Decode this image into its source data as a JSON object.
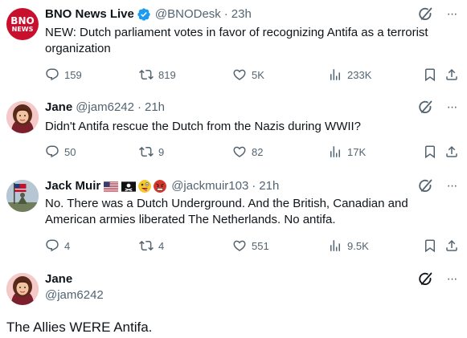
{
  "tweets": [
    {
      "name": "BNO News Live",
      "handle": "@BNODesk",
      "sep": "·",
      "time": "23h",
      "avatar_text_top": "BNO",
      "avatar_text_bottom": "NEWS",
      "verified": true,
      "text": "NEW: Dutch parliament votes in favor of recognizing Antifa as a terrorist organization",
      "replies": "159",
      "retweets": "819",
      "likes": "5K",
      "views": "233K"
    },
    {
      "name": "Jane",
      "handle": "@jam6242",
      "sep": "·",
      "time": "21h",
      "text": "Didn't Antifa rescue the Dutch from the Nazis during WWII?",
      "replies": "50",
      "retweets": "9",
      "likes": "82",
      "views": "17K"
    },
    {
      "name": "Jack Muir",
      "handle": "@jackmuir103",
      "sep": "·",
      "time": "21h",
      "text": "No.  There was a Dutch Underground.  And the British, Canadian and American armies liberated The Netherlands.  No antifa.",
      "replies": "4",
      "retweets": "4",
      "likes": "551",
      "views": "9.5K"
    }
  ],
  "focused_tweet": {
    "name": "Jane",
    "handle": "@jam6242",
    "text": "The Allies WERE Antifa."
  },
  "colors": {
    "text": "#0f1419",
    "secondary": "#536471",
    "verified": "#1d9bf0",
    "bno_red": "#c8102e",
    "thread_line": "#cfd9de"
  },
  "icons": {
    "more": "···"
  }
}
